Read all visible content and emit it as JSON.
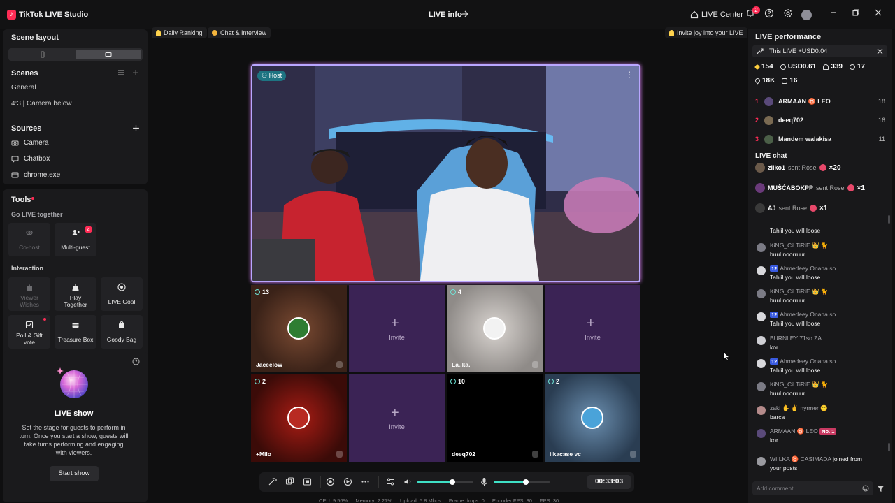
{
  "titlebar": {
    "app_title": "TikTok LIVE Studio",
    "live_info": "LIVE info",
    "live_center": "LIVE Center",
    "notification_count": "2"
  },
  "left": {
    "scene_layout": "Scene layout",
    "scenes_title": "Scenes",
    "scenes": [
      "General",
      "4:3 | Camera below"
    ],
    "sources_title": "Sources",
    "sources": [
      "Camera",
      "Chatbox",
      "chrome.exe"
    ],
    "tools_title": "Tools",
    "go_live_together": "Go LIVE together",
    "cohost": "Co-host",
    "multiguest": "Multi-guest",
    "multiguest_badge": "4",
    "interaction": "Interaction",
    "viewer_wishes_1": "Viewer",
    "viewer_wishes_2": "Wishes",
    "play_together_1": "Play",
    "play_together_2": "Together",
    "live_goal": "LIVE Goal",
    "poll_1": "Poll & Gift",
    "poll_2": "vote",
    "treasure_box": "Treasure Box",
    "goody_bag": "Goody Bag",
    "live_show_title": "LIVE show",
    "live_show_desc_1": "Set the stage for guests to perform in",
    "live_show_desc_2": "turn. Once you start a show, guests will",
    "live_show_desc_3": "take turns performing and engaging",
    "live_show_desc_4": "with viewers.",
    "start_show": "Start show"
  },
  "center": {
    "chip_daily_ranking": "Daily Ranking",
    "chip_chat_interview": "Chat & Interview",
    "invite_joy": "Invite joy into your LIVE",
    "host_tag": "Host",
    "guests": [
      {
        "count": "13",
        "name": "Jaceelow",
        "type": "guest"
      },
      {
        "count": "",
        "name": "Invite",
        "type": "invite"
      },
      {
        "count": "4",
        "name": "La..ka.",
        "type": "guest"
      },
      {
        "count": "",
        "name": "Invite",
        "type": "invite"
      },
      {
        "count": "2",
        "name": "+Milo",
        "type": "guest"
      },
      {
        "count": "",
        "name": "Invite",
        "type": "invite"
      },
      {
        "count": "10",
        "name": "deeq702",
        "type": "guest"
      },
      {
        "count": "2",
        "name": "ilkacase vc",
        "type": "guest"
      }
    ],
    "timer": "00:33:03",
    "stats": {
      "cpu": "CPU: 9.56%",
      "memory": "Memory: 2.21%",
      "upload": "Upload: 5.8 Mbps",
      "frame_drops": "Frame drops: 0",
      "encoder_fps": "Encoder FPS: 30",
      "fps": "FPS: 30"
    }
  },
  "right": {
    "live_performance": "LIVE performance",
    "this_live": "This LIVE +USD0.04",
    "kpi_diamonds": "154",
    "kpi_usd": "USD0.61",
    "kpi_viewers": "339",
    "kpi_new": "17",
    "kpi_likes": "18K",
    "kpi_gifts": "16",
    "ranking": [
      {
        "rank": "1",
        "name": "ARMAAN ♉ LEO",
        "score": "18"
      },
      {
        "rank": "2",
        "name": "deeq702",
        "score": "16"
      },
      {
        "rank": "3",
        "name": "Mandem walakisa",
        "score": "11"
      }
    ],
    "live_chat": "LIVE chat",
    "gifts": [
      {
        "user": "ziiko1",
        "action": "sent Rose",
        "count": "×20"
      },
      {
        "user": "MUŠĆABOKPP",
        "action": "sent Rose",
        "count": "×1"
      },
      {
        "user": "AJ",
        "action": "sent Rose",
        "count": "×1"
      }
    ],
    "messages": [
      {
        "user": "",
        "text": "Tahlil you will loose",
        "level": ""
      },
      {
        "user": "KiNG_CiLTiRiE 👑 🐈",
        "text": "buul noorruur",
        "level": ""
      },
      {
        "user": "Ahmedeey Onana so",
        "text": "Tahlil you will loose",
        "level": "12"
      },
      {
        "user": "KiNG_CiLTiRiE 👑 🐈",
        "text": "buul noorruur",
        "level": ""
      },
      {
        "user": "Ahmedeey Onana so",
        "text": "Tahlil you will loose",
        "level": "12"
      },
      {
        "user": "BURNLEY 71so ZA",
        "text": "kor",
        "level": ""
      },
      {
        "user": "Ahmedeey Onana so",
        "text": "Tahlil you will loose",
        "level": "12"
      },
      {
        "user": "KiNG_CiLTiRiE 👑 🐈",
        "text": "buul noorruur",
        "level": ""
      },
      {
        "user": "zaki ✋ ✌ nyrmer 🙂",
        "text": "barca",
        "level": ""
      },
      {
        "user": "ARMAAN ♉ LEO",
        "text": "kor",
        "level": "No. 1"
      },
      {
        "user": "WIILKA ♉ CASIMADA",
        "text": "your posts",
        "level": "joined from"
      }
    ],
    "add_comment": "Add comment"
  }
}
